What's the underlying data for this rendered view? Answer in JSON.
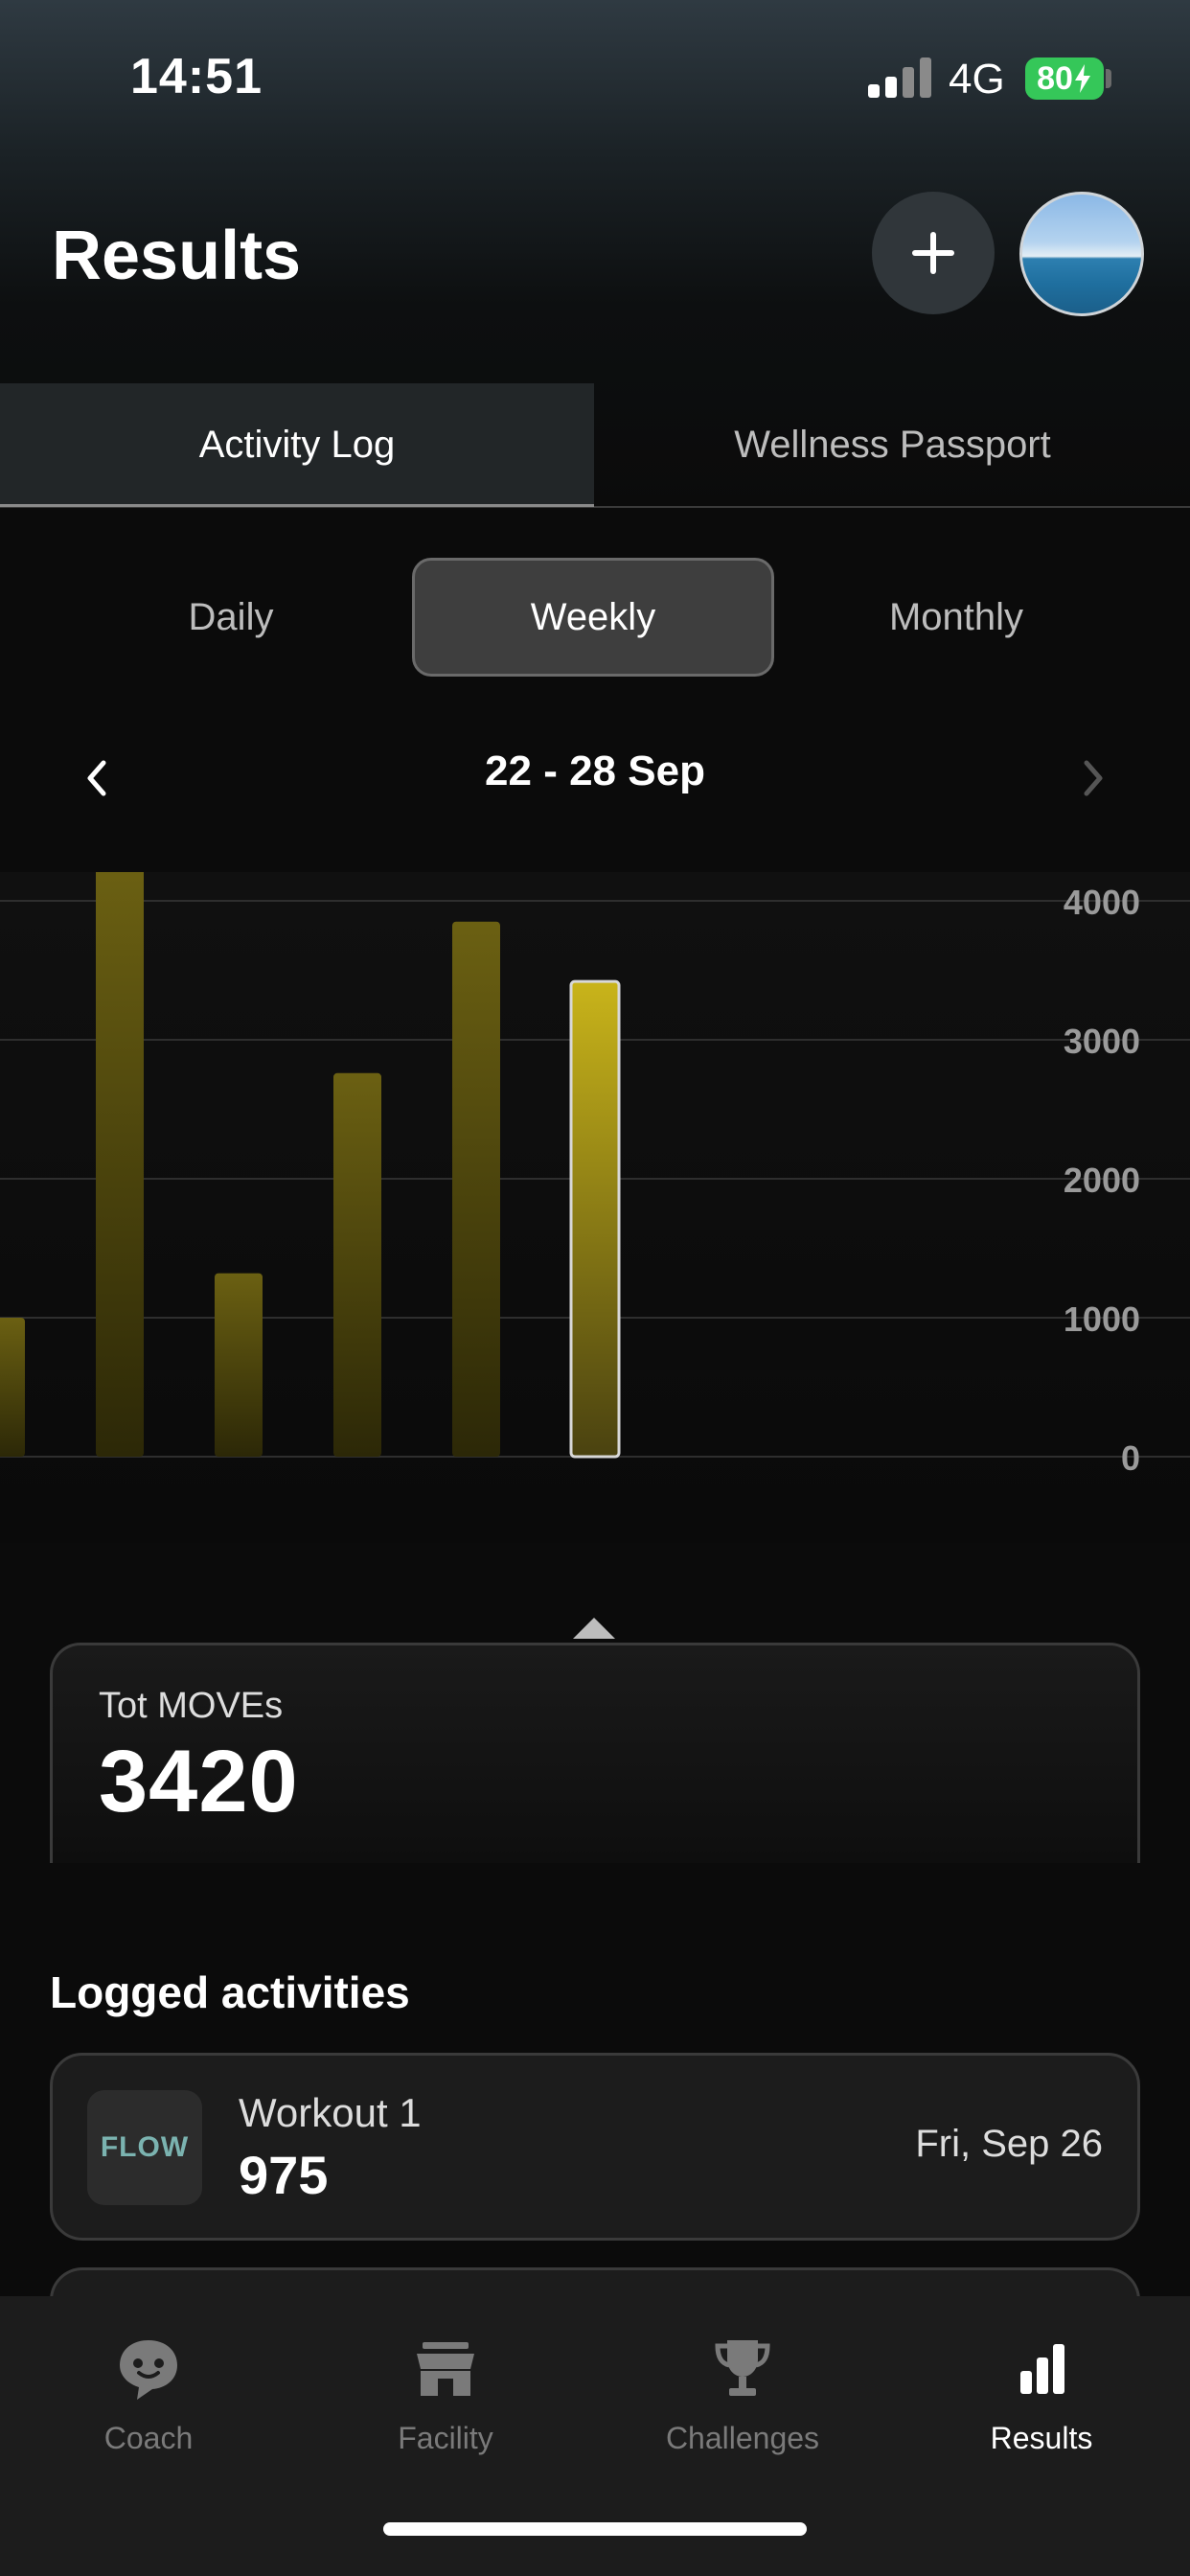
{
  "status_bar": {
    "time": "14:51",
    "network": "4G",
    "battery": "80"
  },
  "header": {
    "title": "Results"
  },
  "tabs": [
    {
      "label": "Activity Log",
      "active": true
    },
    {
      "label": "Wellness Passport",
      "active": false
    }
  ],
  "periods": [
    {
      "label": "Daily",
      "selected": false
    },
    {
      "label": "Weekly",
      "selected": true
    },
    {
      "label": "Monthly",
      "selected": false
    }
  ],
  "date_range": "22 - 28 Sep",
  "chart_data": {
    "type": "bar",
    "ylim": [
      0,
      4000
    ],
    "yticks": [
      "4000",
      "3000",
      "2000",
      "1000",
      "0"
    ],
    "values": [
      1000,
      4250,
      1320,
      2760,
      3850,
      3420
    ],
    "selected_index": 5,
    "grid": true,
    "colors": {
      "bar": "#6b6012",
      "selected_bar": "#c9b41a"
    }
  },
  "summary": {
    "label": "Tot MOVEs",
    "value": "3420"
  },
  "logged_section": {
    "title": "Logged activities"
  },
  "activities": [
    {
      "icon": "flow-logo-icon",
      "icon_text": "FLOW",
      "name": "Workout 1",
      "value": "975",
      "date": "Fri, Sep 26"
    }
  ],
  "bottom_nav": [
    {
      "label": "Coach",
      "icon": "chat-bubble-icon",
      "active": false
    },
    {
      "label": "Facility",
      "icon": "storefront-icon",
      "active": false
    },
    {
      "label": "Challenges",
      "icon": "trophy-icon",
      "active": false
    },
    {
      "label": "Results",
      "icon": "bar-chart-icon",
      "active": true
    }
  ]
}
